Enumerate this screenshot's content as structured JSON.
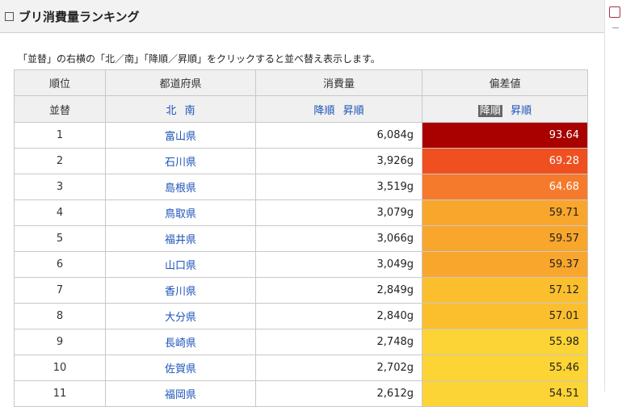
{
  "header": {
    "title": "ブリ消費量ランキング"
  },
  "note": "「並替」の右横の「北／南」「降順／昇順」をクリックすると並べ替え表示します。",
  "table": {
    "headers": [
      "順位",
      "都道府県",
      "消費量",
      "偏差値"
    ],
    "sort_row": {
      "label": "並替",
      "region_north": "北",
      "region_south": "南",
      "consumption_desc": "降順",
      "consumption_asc": "昇順",
      "deviation_desc": "降順",
      "deviation_asc": "昇順"
    },
    "rows": [
      {
        "rank": "1",
        "prefecture": "富山県",
        "consumption": "6,084g",
        "deviation": "93.64",
        "color": "#a90000",
        "text_color": "#ffffff"
      },
      {
        "rank": "2",
        "prefecture": "石川県",
        "consumption": "3,926g",
        "deviation": "69.28",
        "color": "#f04f1f",
        "text_color": "#ffffff"
      },
      {
        "rank": "3",
        "prefecture": "島根県",
        "consumption": "3,519g",
        "deviation": "64.68",
        "color": "#f57a2c",
        "text_color": "#ffffff"
      },
      {
        "rank": "4",
        "prefecture": "鳥取県",
        "consumption": "3,079g",
        "deviation": "59.71",
        "color": "#f9a62c",
        "text_color": "#222222"
      },
      {
        "rank": "5",
        "prefecture": "福井県",
        "consumption": "3,066g",
        "deviation": "59.57",
        "color": "#f9a62c",
        "text_color": "#222222"
      },
      {
        "rank": "6",
        "prefecture": "山口県",
        "consumption": "3,049g",
        "deviation": "59.37",
        "color": "#f9a62c",
        "text_color": "#222222"
      },
      {
        "rank": "7",
        "prefecture": "香川県",
        "consumption": "2,849g",
        "deviation": "57.12",
        "color": "#fbbf2e",
        "text_color": "#222222"
      },
      {
        "rank": "8",
        "prefecture": "大分県",
        "consumption": "2,840g",
        "deviation": "57.01",
        "color": "#fbbf2e",
        "text_color": "#222222"
      },
      {
        "rank": "9",
        "prefecture": "長崎県",
        "consumption": "2,748g",
        "deviation": "55.98",
        "color": "#fdd435",
        "text_color": "#222222"
      },
      {
        "rank": "10",
        "prefecture": "佐賀県",
        "consumption": "2,702g",
        "deviation": "55.46",
        "color": "#fdd435",
        "text_color": "#222222"
      },
      {
        "rank": "11",
        "prefecture": "福岡県",
        "consumption": "2,612g",
        "deviation": "54.51",
        "color": "#fdd435",
        "text_color": "#222222"
      }
    ]
  }
}
